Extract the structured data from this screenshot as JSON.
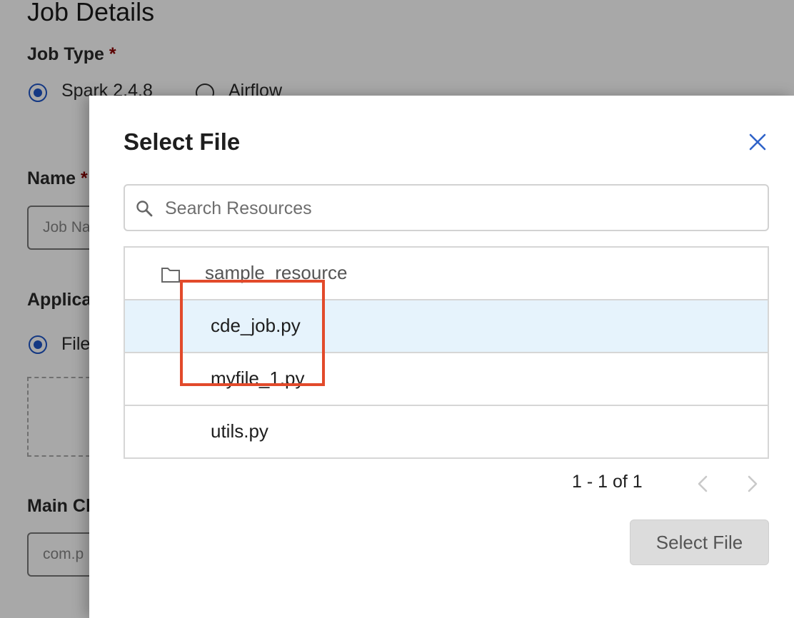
{
  "background": {
    "page_title": "Job Details",
    "job_type_label": "Job Type",
    "required_mark": "*",
    "job_type_options": [
      "Spark 2.4.8",
      "Airflow"
    ],
    "name_label": "Name",
    "name_placeholder": "Job Name",
    "application_label": "Application",
    "application_option": "File",
    "main_class_label": "Main Class",
    "main_class_placeholder": "com.p"
  },
  "modal": {
    "title": "Select File",
    "search": {
      "placeholder": "Search Resources",
      "value": ""
    },
    "folder": "sample_resource",
    "files": [
      "cde_job.py",
      "myfile_1.py",
      "utils.py"
    ],
    "selected_file": "cde_job.py",
    "pagination": {
      "text": "1 - 1 of 1"
    },
    "select_button_label": "Select File"
  },
  "colors": {
    "accent": "#1f55c7",
    "selected_row": "#e6f3fc",
    "highlight": "#e24a2b",
    "disabled_button": "#dcdcdc"
  }
}
